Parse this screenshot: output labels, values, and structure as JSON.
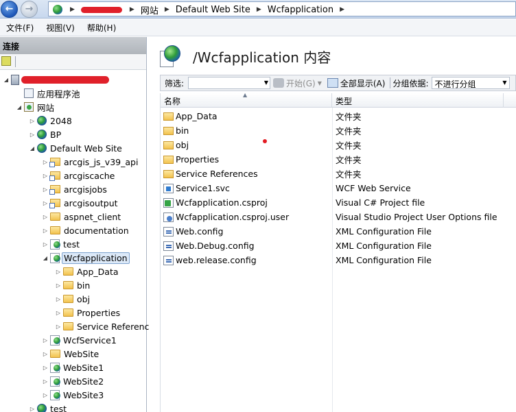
{
  "address_bar": {
    "crumbs": [
      "网站",
      "Default Web Site",
      "Wcfapplication"
    ]
  },
  "menu": [
    "文件(F)",
    "视图(V)",
    "帮助(H)"
  ],
  "connections": {
    "header": "连接",
    "tree": [
      {
        "label": "",
        "icon": "server-icon",
        "level": 0,
        "expand": "expanded",
        "redacted": true
      },
      {
        "label": "应用程序池",
        "icon": "app-pool-icon",
        "level": 1,
        "expand": "none"
      },
      {
        "label": "网站",
        "icon": "sites-icon",
        "level": 1,
        "expand": "expanded"
      },
      {
        "label": "2048",
        "icon": "globe-icon",
        "level": 2,
        "expand": "collapsed"
      },
      {
        "label": "BP",
        "icon": "globe-icon",
        "level": 2,
        "expand": "collapsed"
      },
      {
        "label": "Default Web Site",
        "icon": "globe-icon",
        "level": 2,
        "expand": "expanded"
      },
      {
        "label": "arcgis_js_v39_api",
        "icon": "virtual-dir-icon",
        "level": 3,
        "expand": "collapsed"
      },
      {
        "label": "arcgiscache",
        "icon": "virtual-dir-icon",
        "level": 3,
        "expand": "collapsed"
      },
      {
        "label": "arcgisjobs",
        "icon": "virtual-dir-icon",
        "level": 3,
        "expand": "collapsed"
      },
      {
        "label": "arcgisoutput",
        "icon": "virtual-dir-icon",
        "level": 3,
        "expand": "collapsed"
      },
      {
        "label": "aspnet_client",
        "icon": "folder-icon",
        "level": 3,
        "expand": "collapsed"
      },
      {
        "label": "documentation",
        "icon": "folder-icon",
        "level": 3,
        "expand": "collapsed"
      },
      {
        "label": "test",
        "icon": "web-app-icon",
        "level": 3,
        "expand": "collapsed"
      },
      {
        "label": "Wcfapplication",
        "icon": "web-app-icon",
        "level": 3,
        "expand": "expanded",
        "selected": true
      },
      {
        "label": "App_Data",
        "icon": "folder-icon",
        "level": 4,
        "expand": "collapsed"
      },
      {
        "label": "bin",
        "icon": "folder-icon",
        "level": 4,
        "expand": "collapsed"
      },
      {
        "label": "obj",
        "icon": "folder-icon",
        "level": 4,
        "expand": "collapsed"
      },
      {
        "label": "Properties",
        "icon": "folder-icon",
        "level": 4,
        "expand": "collapsed"
      },
      {
        "label": "Service Referenc",
        "icon": "folder-icon",
        "level": 4,
        "expand": "collapsed"
      },
      {
        "label": "WcfService1",
        "icon": "web-app-icon",
        "level": 3,
        "expand": "collapsed"
      },
      {
        "label": "WebSite",
        "icon": "folder-icon",
        "level": 3,
        "expand": "collapsed"
      },
      {
        "label": "WebSite1",
        "icon": "web-app-icon",
        "level": 3,
        "expand": "collapsed"
      },
      {
        "label": "WebSite2",
        "icon": "web-app-icon",
        "level": 3,
        "expand": "collapsed"
      },
      {
        "label": "WebSite3",
        "icon": "web-app-icon",
        "level": 3,
        "expand": "collapsed"
      },
      {
        "label": "test",
        "icon": "globe-icon",
        "level": 2,
        "expand": "collapsed"
      }
    ]
  },
  "content": {
    "title": "/Wcfapplication 内容",
    "filter": {
      "label": "筛选:",
      "go_label": "开始(G)",
      "show_all_label": "全部显示(A)",
      "group_by_label": "分组依据:",
      "group_by_value": "不进行分组"
    },
    "columns": [
      "名称",
      "类型"
    ],
    "files": [
      {
        "name": "App_Data",
        "type": "文件夹",
        "icon": "folder-icon"
      },
      {
        "name": "bin",
        "type": "文件夹",
        "icon": "folder-icon"
      },
      {
        "name": "obj",
        "type": "文件夹",
        "icon": "folder-icon"
      },
      {
        "name": "Properties",
        "type": "文件夹",
        "icon": "folder-icon"
      },
      {
        "name": "Service References",
        "type": "文件夹",
        "icon": "folder-icon"
      },
      {
        "name": "Service1.svc",
        "type": "WCF Web Service",
        "icon": "svc-file-icon"
      },
      {
        "name": "Wcfapplication.csproj",
        "type": "Visual C# Project file",
        "icon": "csproj-file-icon"
      },
      {
        "name": "Wcfapplication.csproj.user",
        "type": "Visual Studio Project User Options file",
        "icon": "user-file-icon"
      },
      {
        "name": "Web.config",
        "type": "XML Configuration File",
        "icon": "config-file-icon"
      },
      {
        "name": "Web.Debug.config",
        "type": "XML Configuration File",
        "icon": "config-file-icon"
      },
      {
        "name": "web.release.config",
        "type": "XML Configuration File",
        "icon": "config-file-icon"
      }
    ]
  }
}
